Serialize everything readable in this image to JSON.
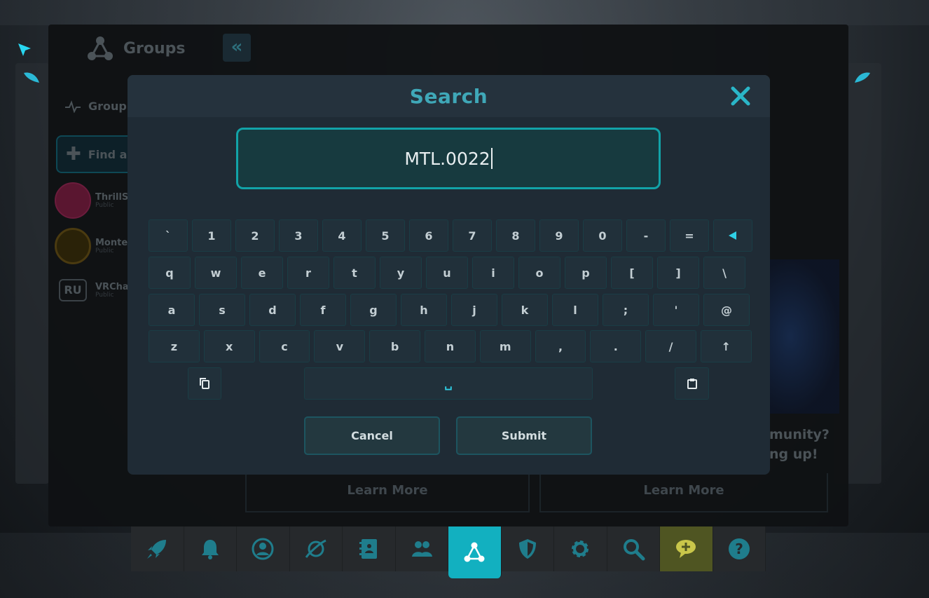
{
  "background": {
    "panel_title": "Groups",
    "collapse_glyph": "«",
    "nav_label": "Group",
    "find_label": "Find a",
    "groups": [
      {
        "name": "ThrillSe",
        "visibility": "Public",
        "avatar_color": "#6b1c3c"
      },
      {
        "name": "Montel",
        "visibility": "Public",
        "avatar_color": "#3a2e0a"
      },
      {
        "name": "VRChat",
        "visibility": "Public",
        "avatar_text": "RU"
      }
    ],
    "card_learn_more_1": "Learn More",
    "card_learn_more_2": "Learn More",
    "right_text_line1": "munity?",
    "right_text_line2": "ng up!"
  },
  "modal": {
    "title": "Search",
    "close_icon": "close-icon",
    "input_value": "MTL.0022",
    "keyboard": {
      "row1": [
        "`",
        "1",
        "2",
        "3",
        "4",
        "5",
        "6",
        "7",
        "8",
        "9",
        "0",
        "-",
        "="
      ],
      "row2": [
        "q",
        "w",
        "e",
        "r",
        "t",
        "y",
        "u",
        "i",
        "o",
        "p",
        "[",
        "]",
        "\\"
      ],
      "row3": [
        "a",
        "s",
        "d",
        "f",
        "g",
        "h",
        "j",
        "k",
        "l",
        ";",
        "'",
        "@"
      ],
      "row4": [
        "z",
        "x",
        "c",
        "v",
        "b",
        "n",
        "m",
        ",",
        ".",
        "/"
      ],
      "shift_glyph": "↑",
      "space_glyph": "␣",
      "backspace_icon": "backspace-icon",
      "copy_icon": "copy-icon",
      "paste_icon": "paste-icon"
    },
    "cancel_label": "Cancel",
    "submit_label": "Submit"
  },
  "dock": [
    {
      "icon": "rocket-icon"
    },
    {
      "icon": "bell-icon"
    },
    {
      "icon": "profile-icon"
    },
    {
      "icon": "planet-icon"
    },
    {
      "icon": "notebook-icon"
    },
    {
      "icon": "friends-icon"
    },
    {
      "icon": "groups-icon",
      "active": true
    },
    {
      "icon": "shield-icon"
    },
    {
      "icon": "gear-icon"
    },
    {
      "icon": "search-icon"
    },
    {
      "icon": "chat-plus-icon"
    },
    {
      "icon": "help-icon"
    }
  ],
  "colors": {
    "accent": "#12b0c0",
    "modal_bg": "#1f2b35",
    "input_border": "#12a3a8",
    "title": "#3fa8b8"
  }
}
